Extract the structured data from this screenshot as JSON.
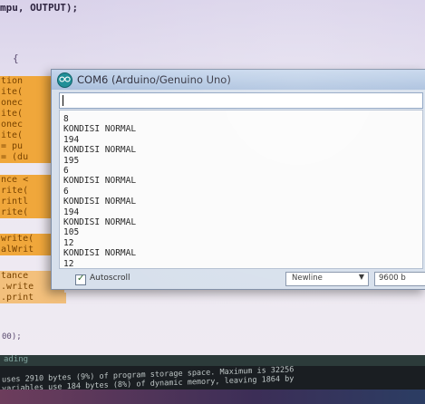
{
  "editor": {
    "lines_top": [
      "mpu, OUTPUT);"
    ],
    "brace": "{",
    "highlight_lines": [
      "tion",
      "ite(",
      "onec",
      "ite(",
      "onec",
      "ite(",
      "= pu",
      "= (du",
      "nce <",
      "rite(",
      "rintl",
      "rite(",
      "write(",
      "alWrit",
      "tance",
      ".write",
      ".print"
    ],
    "tail_line": "00);"
  },
  "console": {
    "header": "ading",
    "line1": "uses 2910 bytes (9%) of program storage space. Maximum is 32256",
    "line2": "variables use 184 bytes (8%) of dynamic memory, leaving 1864 by"
  },
  "serial_monitor": {
    "title": "COM6 (Arduino/Genuino Uno)",
    "send_value": "",
    "output_lines": [
      "8",
      "KONDISI NORMAL",
      "194",
      "KONDISI NORMAL",
      "195",
      "6",
      "KONDISI NORMAL",
      "6",
      "KONDISI NORMAL",
      "194",
      "KONDISI NORMAL",
      "105",
      "12",
      "KONDISI NORMAL",
      "12"
    ],
    "autoscroll_label": "Autoscroll",
    "autoscroll_checked": true,
    "line_ending": "Newline",
    "baud_rate": "9600 b"
  },
  "colors": {
    "highlight": "#f0a73b",
    "titlebar": "#a9bfdd",
    "app_icon": "#1e8e96"
  },
  "icons": {
    "app_icon": "arduino-infinity-icon",
    "dropdown": "chevron-down-icon"
  }
}
